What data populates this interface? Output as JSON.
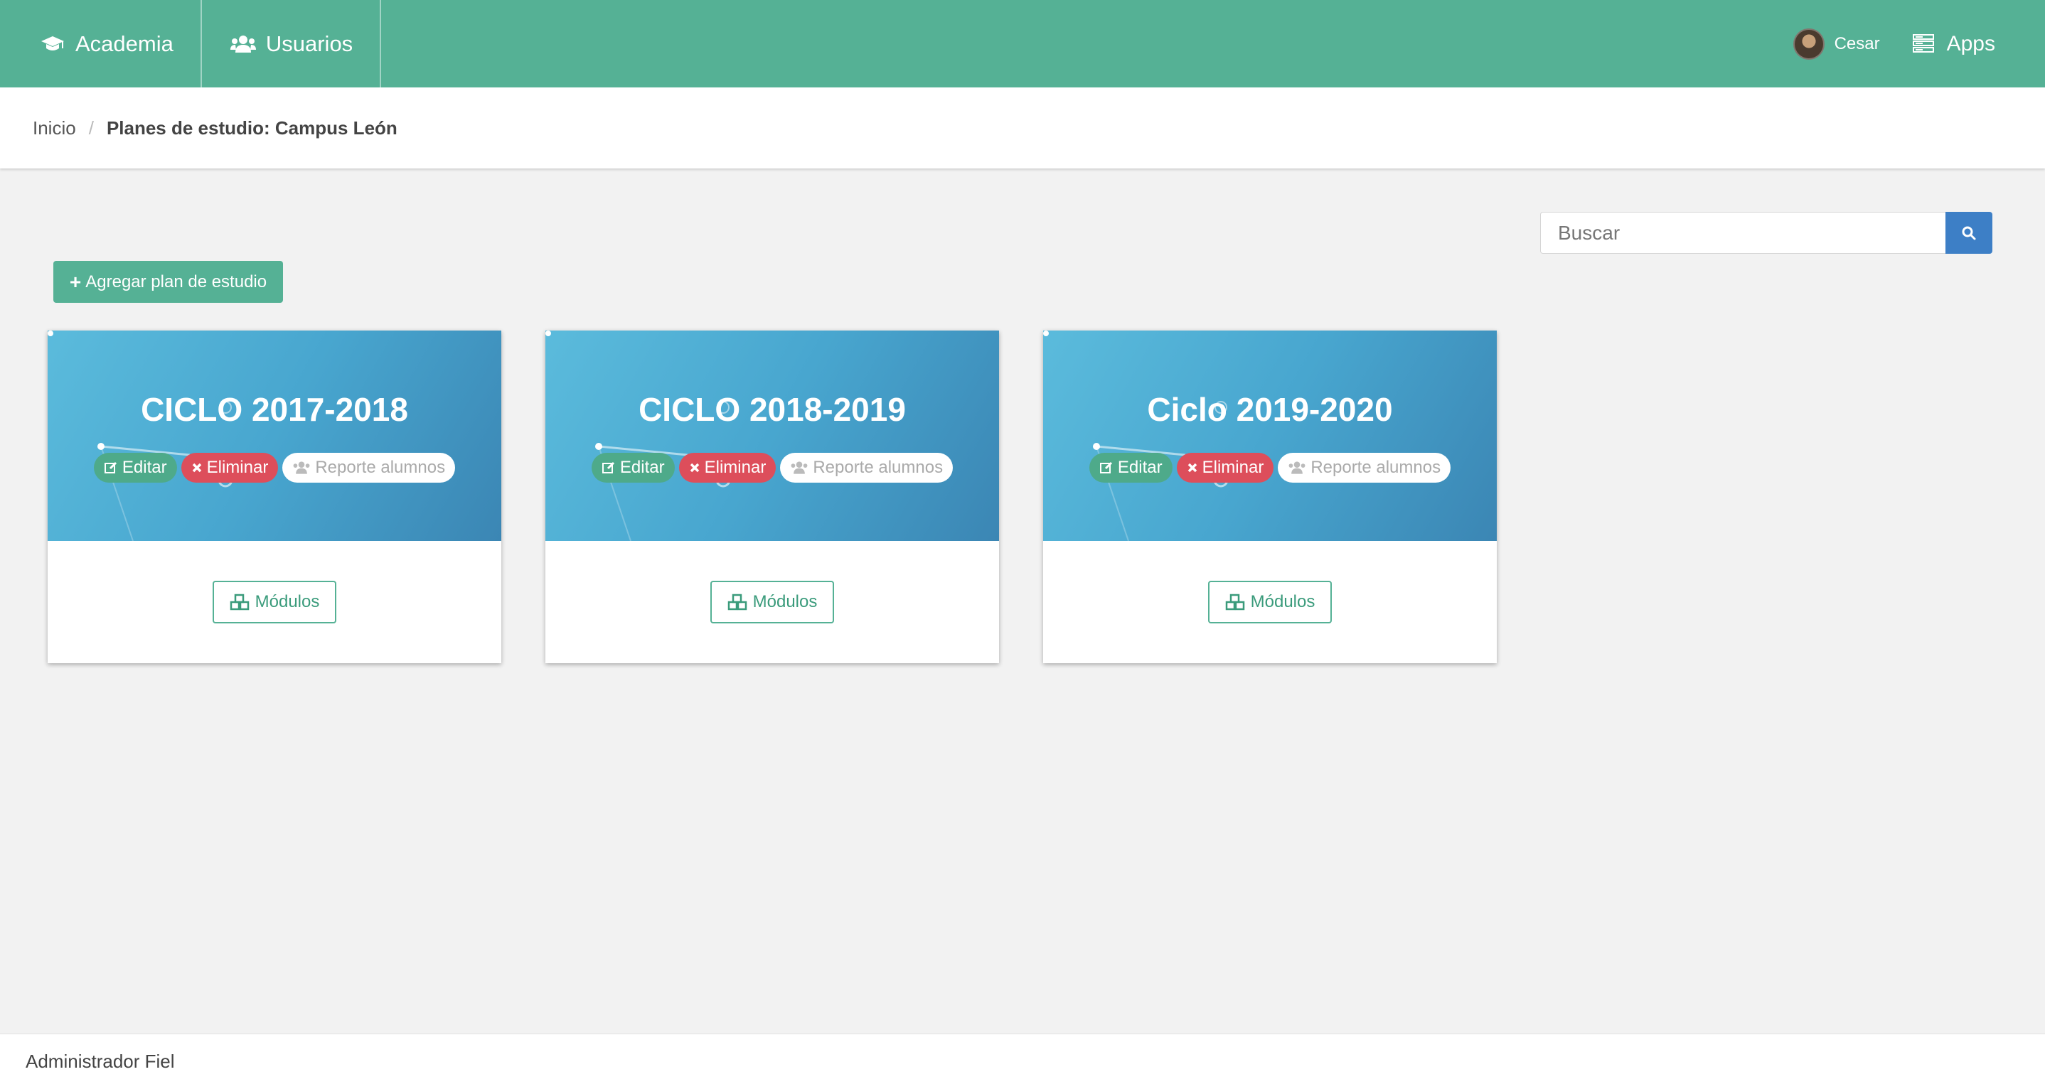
{
  "navbar": {
    "items": [
      {
        "label": "Academia",
        "icon": "graduation-cap-icon"
      },
      {
        "label": "Usuarios",
        "icon": "users-icon"
      }
    ],
    "user": {
      "name": "Cesar"
    },
    "apps_label": "Apps",
    "color": "#55b195"
  },
  "breadcrumb": {
    "home": "Inicio",
    "separator": "/",
    "current": "Planes de estudio: Campus León"
  },
  "search": {
    "placeholder": "Buscar"
  },
  "add_button": {
    "label": "Agregar plan de estudio"
  },
  "cards": [
    {
      "title": "CICLO 2017-2018",
      "edit": "Editar",
      "delete": "Eliminar",
      "report": "Reporte alumnos",
      "modules": "Módulos"
    },
    {
      "title": "CICLO 2018-2019",
      "edit": "Editar",
      "delete": "Eliminar",
      "report": "Reporte alumnos",
      "modules": "Módulos"
    },
    {
      "title": "Ciclo 2019-2020",
      "edit": "Editar",
      "delete": "Eliminar",
      "report": "Reporte alumnos",
      "modules": "Módulos"
    }
  ],
  "footer": {
    "text": "Administrador Fiel"
  }
}
